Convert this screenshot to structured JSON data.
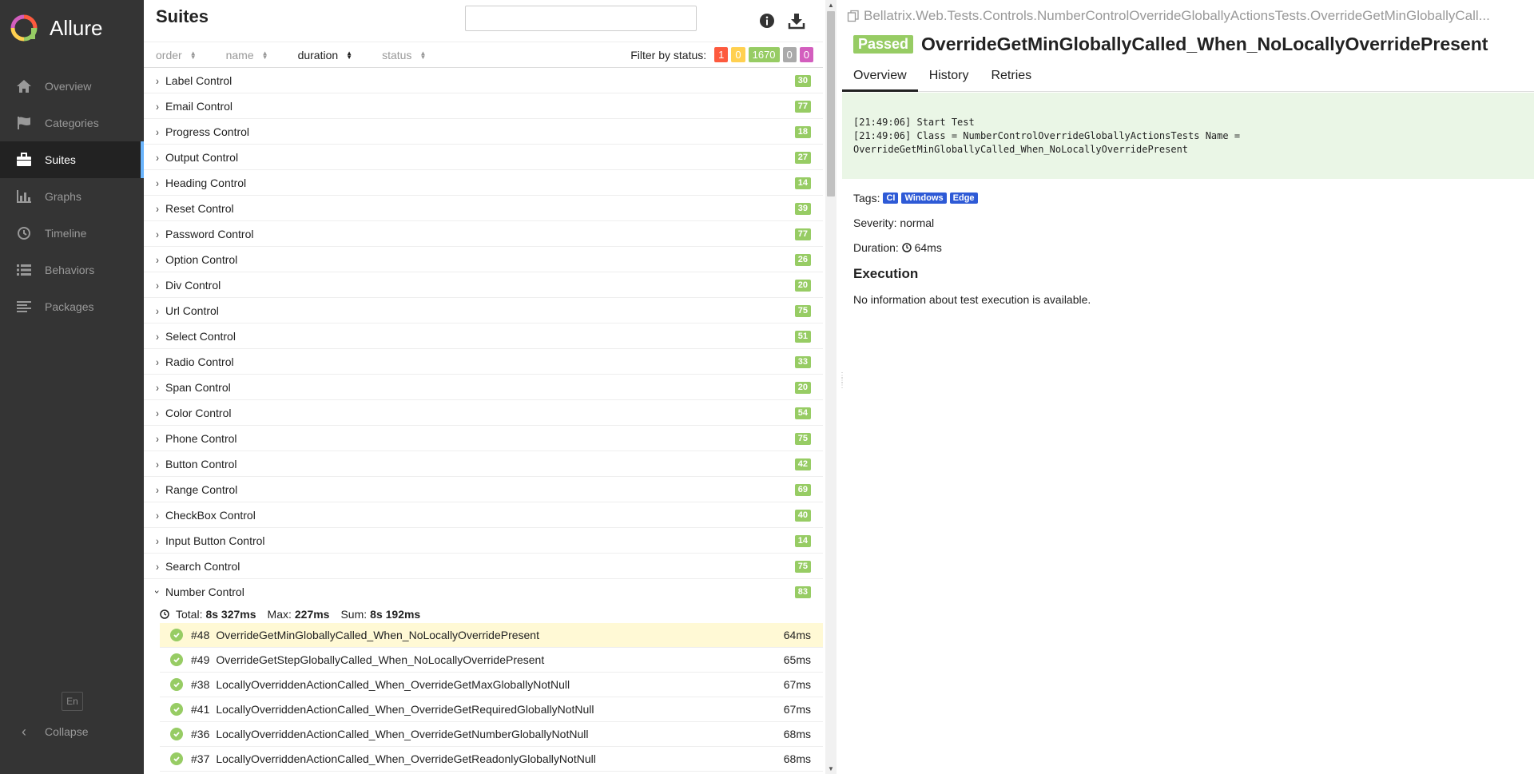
{
  "brand": {
    "name": "Allure"
  },
  "sidebar": {
    "items": [
      {
        "label": "Overview",
        "icon": "home-icon"
      },
      {
        "label": "Categories",
        "icon": "flag-icon"
      },
      {
        "label": "Suites",
        "icon": "briefcase-icon"
      },
      {
        "label": "Graphs",
        "icon": "bar-chart-icon"
      },
      {
        "label": "Timeline",
        "icon": "clock-icon"
      },
      {
        "label": "Behaviors",
        "icon": "list-icon"
      },
      {
        "label": "Packages",
        "icon": "align-left-icon"
      }
    ],
    "active": "Suites",
    "language": "En",
    "collapse_label": "Collapse"
  },
  "suites": {
    "title": "Suites",
    "search_placeholder": "",
    "sort": {
      "order": "order",
      "name": "name",
      "duration": "duration",
      "status": "status",
      "active": "duration"
    },
    "filter": {
      "label": "Filter by status:",
      "badges": [
        {
          "value": "1",
          "color": "#fd5a3e"
        },
        {
          "value": "0",
          "color": "#ffd050"
        },
        {
          "value": "1670",
          "color": "#97cc64"
        },
        {
          "value": "0",
          "color": "#aaaaaa"
        },
        {
          "value": "0",
          "color": "#d35ebe"
        }
      ]
    },
    "groups": [
      {
        "name": "Label Control",
        "count": "30"
      },
      {
        "name": "Email Control",
        "count": "77"
      },
      {
        "name": "Progress Control",
        "count": "18"
      },
      {
        "name": "Output Control",
        "count": "27"
      },
      {
        "name": "Heading Control",
        "count": "14"
      },
      {
        "name": "Reset Control",
        "count": "39"
      },
      {
        "name": "Password Control",
        "count": "77"
      },
      {
        "name": "Option Control",
        "count": "26"
      },
      {
        "name": "Div Control",
        "count": "20"
      },
      {
        "name": "Url Control",
        "count": "75"
      },
      {
        "name": "Select Control",
        "count": "51"
      },
      {
        "name": "Radio Control",
        "count": "33"
      },
      {
        "name": "Span Control",
        "count": "20"
      },
      {
        "name": "Color Control",
        "count": "54"
      },
      {
        "name": "Phone Control",
        "count": "75"
      },
      {
        "name": "Button Control",
        "count": "42"
      },
      {
        "name": "Range Control",
        "count": "69"
      },
      {
        "name": "CheckBox Control",
        "count": "40"
      },
      {
        "name": "Input Button Control",
        "count": "14"
      },
      {
        "name": "Search Control",
        "count": "75"
      }
    ],
    "expanded": {
      "name": "Number Control",
      "count": "83",
      "stats": {
        "total_label": "Total:",
        "total": "8s 327ms",
        "max_label": "Max:",
        "max": "227ms",
        "sum_label": "Sum:",
        "sum": "8s 192ms"
      },
      "tests": [
        {
          "num": "#48",
          "name": "OverrideGetMinGloballyCalled_When_NoLocallyOverridePresent",
          "duration": "64ms",
          "selected": true
        },
        {
          "num": "#49",
          "name": "OverrideGetStepGloballyCalled_When_NoLocallyOverridePresent",
          "duration": "65ms"
        },
        {
          "num": "#38",
          "name": "LocallyOverriddenActionCalled_When_OverrideGetMaxGloballyNotNull",
          "duration": "67ms"
        },
        {
          "num": "#41",
          "name": "LocallyOverriddenActionCalled_When_OverrideGetRequiredGloballyNotNull",
          "duration": "67ms"
        },
        {
          "num": "#36",
          "name": "LocallyOverriddenActionCalled_When_OverrideGetNumberGloballyNotNull",
          "duration": "68ms"
        },
        {
          "num": "#37",
          "name": "LocallyOverriddenActionCalled_When_OverrideGetReadonlyGloballyNotNull",
          "duration": "68ms"
        }
      ]
    }
  },
  "detail": {
    "breadcrumb": "Bellatrix.Web.Tests.Controls.NumberControlOverrideGloballyActionsTests.OverrideGetMinGloballyCall...",
    "status": "Passed",
    "title": "OverrideGetMinGloballyCalled_When_NoLocallyOverridePresent",
    "tabs": [
      "Overview",
      "History",
      "Retries"
    ],
    "log": "[21:49:06] Start Test\n[21:49:06] Class = NumberControlOverrideGloballyActionsTests Name =\nOverrideGetMinGloballyCalled_When_NoLocallyOverridePresent",
    "tags_label": "Tags:",
    "tags": [
      "CI",
      "Windows",
      "Edge"
    ],
    "severity_label": "Severity:",
    "severity": "normal",
    "duration_label": "Duration:",
    "duration": "64ms",
    "execution_title": "Execution",
    "execution_text": "No information about test execution is available."
  }
}
